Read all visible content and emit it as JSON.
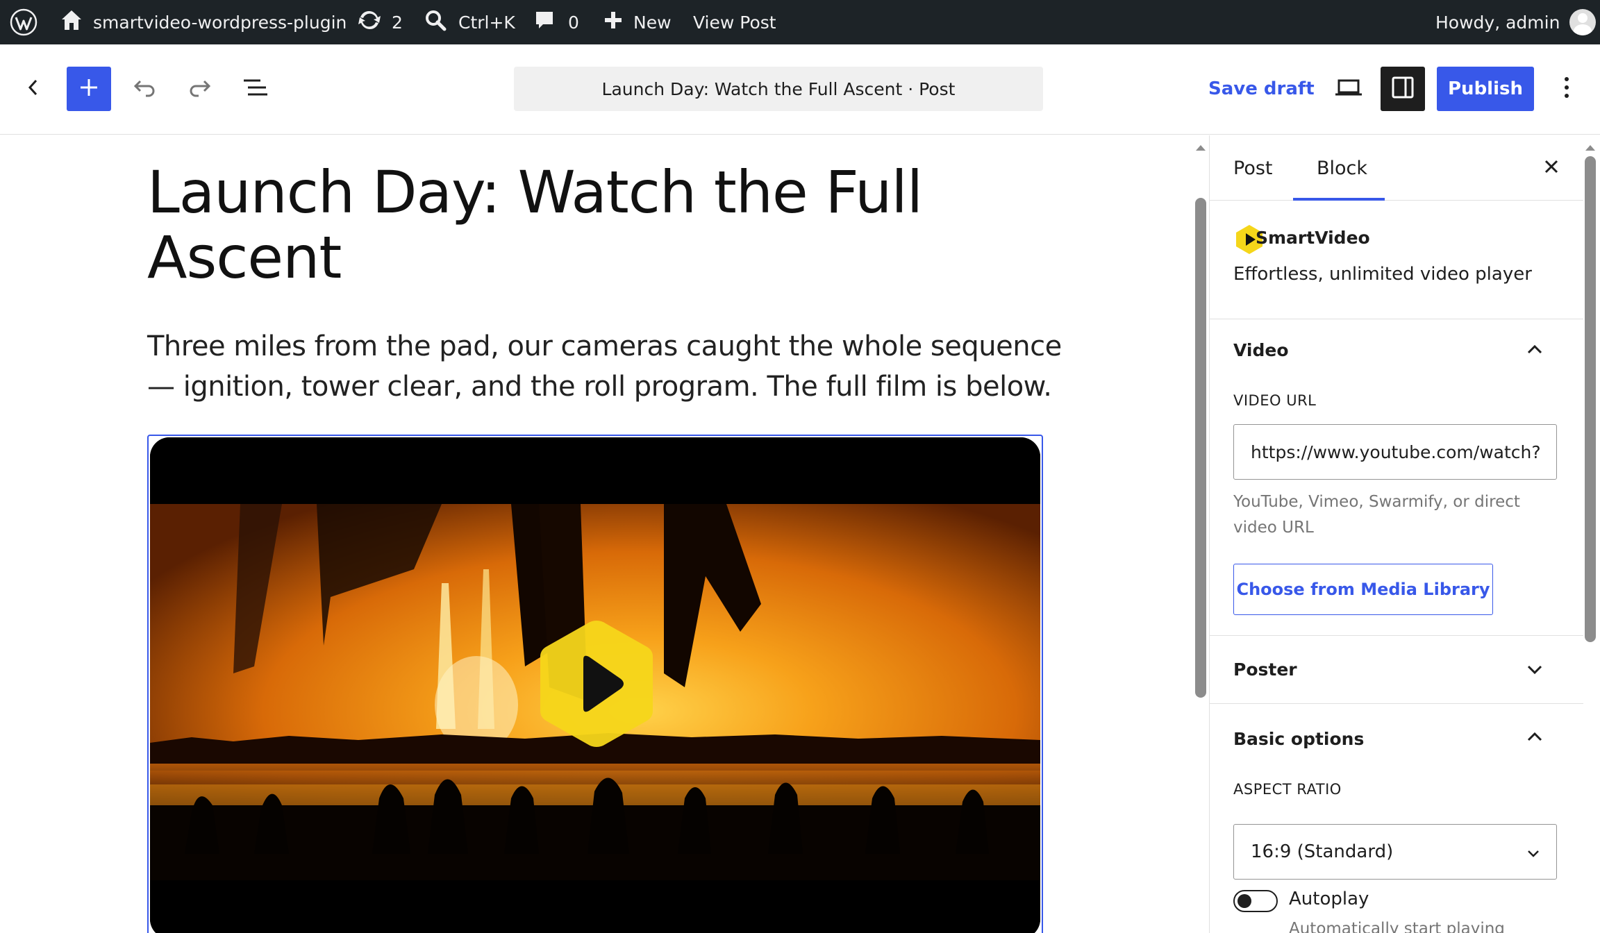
{
  "admin_bar": {
    "site_name": "smartvideo-wordpress-plugin",
    "updates_count": "2",
    "search_shortcut": "Ctrl+K",
    "comments_count": "0",
    "new_label": "New",
    "view_post_label": "View Post",
    "howdy_label": "Howdy, admin"
  },
  "header": {
    "document_title": "Launch Day: Watch the Full Ascent · Post",
    "save_draft_label": "Save draft",
    "publish_label": "Publish"
  },
  "post": {
    "title": "Launch Day: Watch the Full Ascent",
    "paragraph": "Three miles from the pad, our cameras caught the whole sequence — ignition, tower clear, and the roll program. The full film is below."
  },
  "sidebar": {
    "tabs": [
      {
        "label": "Post",
        "active": false
      },
      {
        "label": "Block",
        "active": true
      }
    ],
    "block": {
      "name": "SmartVideo",
      "description": "Effortless, unlimited video player"
    },
    "video_panel": {
      "title": "Video",
      "url_label": "VIDEO URL",
      "url_value": "https://www.youtube.com/watch?",
      "help": "YouTube, Vimeo, Swarmify, or direct video URL",
      "media_button": "Choose from Media Library"
    },
    "poster_panel": {
      "title": "Poster"
    },
    "basic_options": {
      "title": "Basic options",
      "aspect_label": "ASPECT RATIO",
      "aspect_value": "16:9 (Standard)",
      "autoplay_label": "Autoplay",
      "autoplay_on": false,
      "autoplay_help": "Automatically start playing"
    }
  },
  "colors": {
    "admin_bar_bg": "#1d2327",
    "accent": "#3858e9",
    "brand_yellow": "#f5d61a"
  }
}
